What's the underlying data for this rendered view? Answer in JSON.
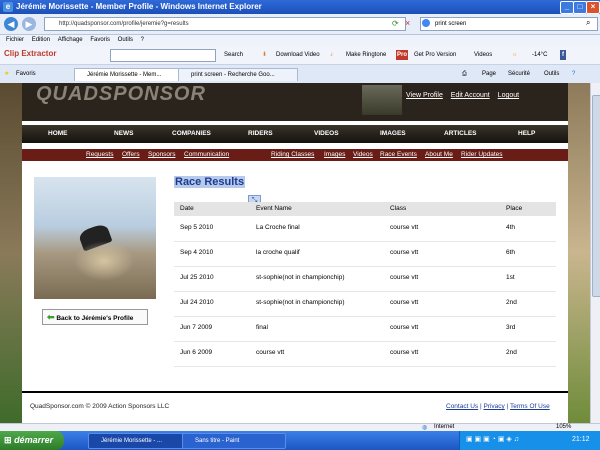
{
  "window": {
    "title": "Jérémie Morissette - Member Profile - Windows Internet Explorer"
  },
  "address": {
    "url": "http://quadsponsor.com/profile/jeremie?g=results",
    "search": "print screen"
  },
  "menu": [
    "Fichier",
    "Edition",
    "Affichage",
    "Favoris",
    "Outils",
    "?"
  ],
  "toolbar": {
    "brand": "Clip Extractor",
    "search": "Search",
    "download": "Download Video",
    "ringtone": "Make Ringtone",
    "pro": "Get Pro Version",
    "videos": "Videos",
    "weather": "-14°C"
  },
  "tabs": {
    "favorites": "Favoris",
    "items": [
      "Jérémie Morissette - Mem...",
      "print screen - Recherche Goo..."
    ],
    "page": "Page",
    "security": "Sécurité",
    "tools": "Outils"
  },
  "site": {
    "logo": "QUADSPONSOR",
    "banner_links": [
      "View Profile",
      "Edit Account",
      "Logout"
    ],
    "nav": [
      "HOME",
      "NEWS",
      "COMPANIES",
      "RIDERS",
      "VIDEOS",
      "IMAGES",
      "ARTICLES",
      "HELP"
    ],
    "subnav_left": [
      "Requests",
      "Offers",
      "Sponsors",
      "Communication"
    ],
    "subnav_right": [
      "Riding Classes",
      "Images",
      "Videos",
      "Race Events",
      "About Me",
      "Rider Updates"
    ],
    "back_button": "Back to Jérémie's Profile",
    "heading": "Race Results",
    "table": {
      "headers": [
        "Date",
        "Event Name",
        "Class",
        "Place"
      ],
      "rows": [
        [
          "Sep 5 2010",
          "La Croche final",
          "course vtt",
          "4th"
        ],
        [
          "Sep 4 2010",
          "la croche qualif",
          "course vtt",
          "6th"
        ],
        [
          "Jul 25 2010",
          "st-sophie(not in championchip)",
          "course vtt",
          "1st"
        ],
        [
          "Jul 24 2010",
          "st-sophie(not in championchip)",
          "course vtt",
          "2nd"
        ],
        [
          "Jun 7 2009",
          "final",
          "course vtt",
          "3rd"
        ],
        [
          "Jun 6 2009",
          "course vtt",
          "course vtt",
          "2nd"
        ]
      ]
    },
    "footer": "QuadSponsor.com © 2009 Action Sponsors LLC",
    "footer_links": [
      "Contact Us",
      "Privacy",
      "Terms Of Use"
    ]
  },
  "status": {
    "zone": "Internet",
    "zoom": "105%"
  },
  "taskbar": {
    "start": "démarrer",
    "tasks": [
      "Jérémie Morissette - ...",
      "Sans titre - Paint"
    ],
    "clock": "21:12"
  },
  "colors": {
    "nav_bg": "#14110c",
    "subnav_bg": "#6a1c16",
    "heading": "#1d3a8f",
    "link": "#1a3d9a"
  }
}
